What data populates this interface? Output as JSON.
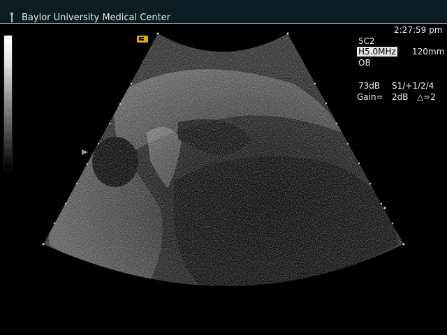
{
  "header": {
    "institution": "Baylor University Medical Center",
    "top_left_clipped": "",
    "top_right_clipped": ""
  },
  "icons": {
    "probe": "probe-icon",
    "orientation": "orientation-marker-icon",
    "focal": "focal-zone-marker-icon"
  },
  "info_panel": {
    "time": "2:27:59 pm",
    "probe_model": "5C2",
    "frequency": "H5.0MHz",
    "depth": "120mm",
    "preset": "OB",
    "dynamic_range": "73dB",
    "persistence": "S1/+1/2/4",
    "gain_label": "Gain=",
    "gain_value": "2dB",
    "delta": "△=2"
  },
  "colors": {
    "header_bg": "#0b1c24",
    "marker": "#e0b000",
    "frequency_highlight": "#e6e6e6"
  }
}
